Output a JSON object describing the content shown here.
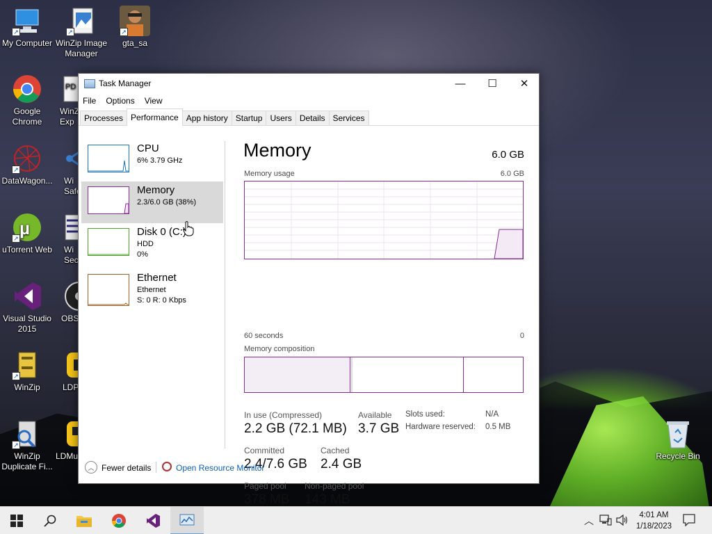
{
  "desktop": {
    "icons": [
      {
        "label": "My Computer"
      },
      {
        "label": "WinZip Image Manager"
      },
      {
        "label": "gta_sa"
      },
      {
        "label": "Google Chrome"
      },
      {
        "label": "WinZ Exp"
      },
      {
        "label": "DataWagon..."
      },
      {
        "label": "Wi Safe"
      },
      {
        "label": "uTorrent Web"
      },
      {
        "label": "Wi Sec"
      },
      {
        "label": "Visual Studio 2015"
      },
      {
        "label": "OBS"
      },
      {
        "label": "WinZip"
      },
      {
        "label": "LDP"
      },
      {
        "label": "WinZip Duplicate Fi..."
      },
      {
        "label": "LDMu"
      },
      {
        "label": "Recycle Bin"
      }
    ]
  },
  "window": {
    "title": "Task Manager",
    "minimize": "—",
    "maximize": "☐",
    "close": "✕",
    "menu": [
      "File",
      "Options",
      "View"
    ],
    "tabs": [
      "Processes",
      "Performance",
      "App history",
      "Startup",
      "Users",
      "Details",
      "Services"
    ],
    "active_tab": "Performance"
  },
  "sidebar": {
    "items": [
      {
        "name": "CPU",
        "line1": "6% 3.79 GHz",
        "line2": "",
        "color": "#1a74b8"
      },
      {
        "name": "Memory",
        "line1": "2.3/6.0 GB (38%)",
        "line2": "",
        "color": "#8b2b9a"
      },
      {
        "name": "Disk 0 (C:)",
        "line1": "HDD",
        "line2": "0%",
        "color": "#4da32a"
      },
      {
        "name": "Ethernet",
        "line1": "Ethernet",
        "line2": "S: 0 R: 0 Kbps",
        "color": "#a0602a"
      }
    ],
    "selected": "Memory"
  },
  "memory": {
    "heading": "Memory",
    "total": "6.0 GB",
    "usage_label": "Memory usage",
    "usage_max": "6.0 GB",
    "time_left": "60 seconds",
    "time_right": "0",
    "composition_label": "Memory composition",
    "stats": {
      "in_use_label": "In use (Compressed)",
      "in_use_value": "2.2 GB (72.1 MB)",
      "available_label": "Available",
      "available_value": "3.7 GB",
      "committed_label": "Committed",
      "committed_value": "2.4/7.6 GB",
      "cached_label": "Cached",
      "cached_value": "2.4 GB",
      "paged_label": "Paged pool",
      "paged_value": "378 MB",
      "nonpaged_label": "Non-paged pool",
      "nonpaged_value": "143 MB",
      "slots_label": "Slots used:",
      "slots_value": "N/A",
      "hwres_label": "Hardware reserved:",
      "hwres_value": "0.5 MB"
    }
  },
  "footer": {
    "fewer_details": "Fewer details",
    "open_resource_monitor": "Open Resource Monitor"
  },
  "taskbar": {
    "time": "4:01 AM",
    "date": "1/18/2023"
  }
}
